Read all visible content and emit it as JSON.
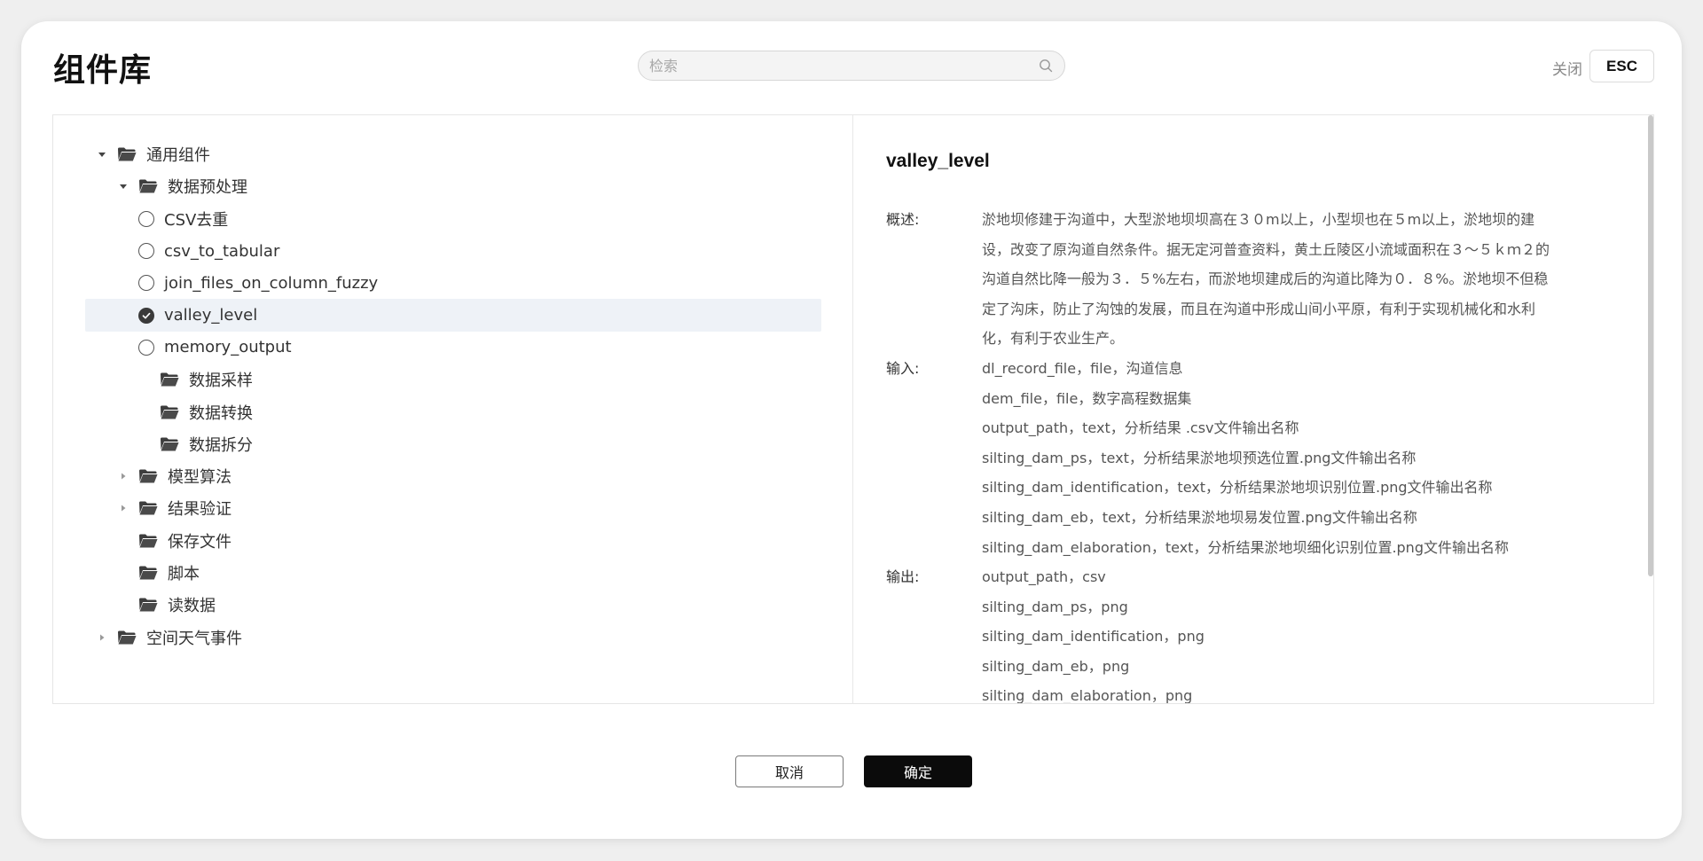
{
  "dialog": {
    "title": "组件库",
    "search": {
      "placeholder": "检索",
      "value": ""
    },
    "close_label": "关闭",
    "esc_label": "ESC"
  },
  "tree": [
    {
      "label": "通用组件",
      "kind": "folder",
      "level": 0,
      "expander": "expanded"
    },
    {
      "label": "数据预处理",
      "kind": "folder",
      "level": 1,
      "expander": "expanded"
    },
    {
      "label": "CSV去重",
      "kind": "radio",
      "level": 2,
      "checked": false
    },
    {
      "label": "csv_to_tabular",
      "kind": "radio",
      "level": 2,
      "checked": false
    },
    {
      "label": "join_files_on_column_fuzzy",
      "kind": "radio",
      "level": 2,
      "checked": false
    },
    {
      "label": "valley_level",
      "kind": "radio",
      "level": 2,
      "checked": true,
      "selected": true
    },
    {
      "label": "memory_output",
      "kind": "radio",
      "level": 2,
      "checked": false
    },
    {
      "label": "数据采样",
      "kind": "folder",
      "level": 2,
      "expander": "none"
    },
    {
      "label": "数据转换",
      "kind": "folder",
      "level": 2,
      "expander": "none"
    },
    {
      "label": "数据拆分",
      "kind": "folder",
      "level": 2,
      "expander": "none"
    },
    {
      "label": "模型算法",
      "kind": "folder",
      "level": 1,
      "expander": "collapsed"
    },
    {
      "label": "结果验证",
      "kind": "folder",
      "level": 1,
      "expander": "collapsed"
    },
    {
      "label": "保存文件",
      "kind": "folder",
      "level": 1,
      "expander": "none"
    },
    {
      "label": "脚本",
      "kind": "folder",
      "level": 1,
      "expander": "none"
    },
    {
      "label": "读数据",
      "kind": "folder",
      "level": 1,
      "expander": "none"
    },
    {
      "label": "空间天气事件",
      "kind": "folder",
      "level": 0,
      "expander": "collapsed"
    }
  ],
  "detail": {
    "name": "valley_level",
    "overview_label": "概述:",
    "overview_lines": [
      "淤地坝修建于沟道中，大型淤地坝坝高在３０m以上，小型坝也在５m以上，淤地坝的建",
      "设，改变了原沟道自然条件。据无定河普查资料，黄土丘陵区小流域面积在３～５ｋｍ２的",
      "沟道自然比降一般为３．５%左右，而淤地坝建成后的沟道比降为０．８%。淤地坝不但稳",
      "定了沟床，防止了沟蚀的发展，而且在沟道中形成山间小平原，有利于实现机械化和水利",
      "化，有利于农业生产。"
    ],
    "input_label": "输入:",
    "inputs": [
      "dl_record_file，file，沟道信息",
      "dem_file，file，数字高程数据集",
      "output_path，text，分析结果 .csv文件输出名称",
      "silting_dam_ps，text，分析结果淤地坝预选位置.png文件输出名称",
      "silting_dam_identification，text，分析结果淤地坝识别位置.png文件输出名称",
      "silting_dam_eb，text，分析结果淤地坝易发位置.png文件输出名称",
      "silting_dam_elaboration，text，分析结果淤地坝细化识别位置.png文件输出名称"
    ],
    "output_label": "输出:",
    "outputs": [
      "output_path，csv",
      "silting_dam_ps，png",
      "silting_dam_identification，png",
      "silting_dam_eb，png",
      "silting_dam_elaboration，png"
    ]
  },
  "footer": {
    "cancel_label": "取消",
    "ok_label": "确定"
  },
  "colors": {
    "selected_row_bg": "#eef2f7",
    "primary_button": "#0b0b0b"
  }
}
